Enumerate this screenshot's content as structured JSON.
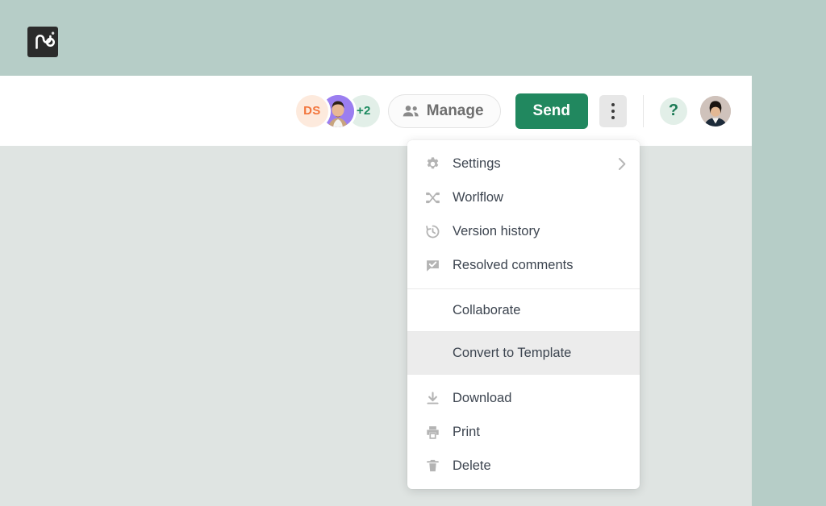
{
  "brand": {
    "logo_name": "pandadoc-logo",
    "logo_bg": "#2b2b2b",
    "page_bg": "#b6cdc7"
  },
  "header": {
    "background": "#ffffff",
    "content_bg": "#dfe4e2",
    "avatars": [
      {
        "type": "initials",
        "label": "DS",
        "bg": "#fdeadd",
        "fg": "#f2753c"
      },
      {
        "type": "photo",
        "label": "",
        "bg": "#9b7ef0",
        "fg": "#ffffff"
      },
      {
        "type": "count",
        "label": "+2",
        "bg": "#e2efe8",
        "fg": "#1b8a5f"
      }
    ],
    "manage_button": {
      "label": "Manage",
      "icon": "people-icon"
    },
    "send_button": {
      "label": "Send",
      "color": "#21885f"
    },
    "kebab_button": {
      "icon": "kebab-menu-icon"
    },
    "help_button": {
      "label": "?",
      "bg": "#e2efe8",
      "fg": "#1b7a55"
    },
    "user_avatar": {
      "name": "user-avatar"
    }
  },
  "dropdown": {
    "sections": [
      {
        "items": [
          {
            "label": "Settings",
            "icon": "gear-icon",
            "submenu": true,
            "active": false
          },
          {
            "label": "Worlflow",
            "icon": "workflow-icon",
            "submenu": false,
            "active": false
          },
          {
            "label": "Version history",
            "icon": "clock-history-icon",
            "submenu": false,
            "active": false
          },
          {
            "label": "Resolved comments",
            "icon": "comment-check-icon",
            "submenu": false,
            "active": false
          }
        ]
      },
      {
        "items": [
          {
            "label": "Collaborate",
            "icon": "",
            "submenu": false,
            "active": false
          }
        ]
      },
      {
        "items": [
          {
            "label": "Convert to Template",
            "icon": "",
            "submenu": false,
            "active": true
          }
        ]
      },
      {
        "items": [
          {
            "label": "Download",
            "icon": "download-icon",
            "submenu": false,
            "active": false
          },
          {
            "label": "Print",
            "icon": "printer-icon",
            "submenu": false,
            "active": false
          },
          {
            "label": "Delete",
            "icon": "trash-icon",
            "submenu": false,
            "active": false
          }
        ]
      }
    ]
  }
}
